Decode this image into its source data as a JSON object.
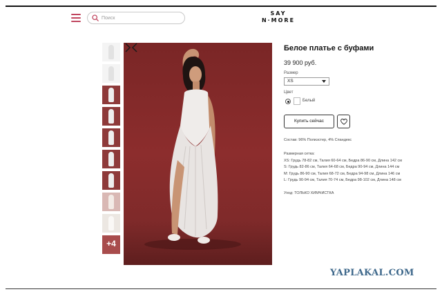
{
  "header": {
    "search_placeholder": "Поиск",
    "logo_line1": "SAY",
    "logo_line2": "N·MORE",
    "accent_color": "#c0455e"
  },
  "gallery": {
    "thumbnail_count": 10,
    "more_label": "+4",
    "photo_background_color": "#8c2d2d"
  },
  "product": {
    "title": "Белое платье с буфами",
    "price": "39 900 руб.",
    "size_label": "Размер",
    "size_value": "XS",
    "color_label": "Цвет",
    "color_name": "Белый",
    "buy_button": "Купить сейчас",
    "composition": "Состав: 96% Полиэстер, 4% Спандекс",
    "size_chart_title": "Размерная сетка:",
    "size_chart": [
      "XS: Грудь 78-82 см, Талия 60-64 см, Бедра 86-90 см, Длина 142 см",
      "S: Грудь 82-86 см, Талия 64-68 см, Бедра 90-94 см, Длина 144 см",
      "M: Грудь 86-90 см, Талия 68-72 см, Бедра 94-98 см, Длина 146 см",
      "L: Грудь 90-94 см, Талия 70-74 см, Бедра 98-102 см, Длина 148 см"
    ],
    "care": "Уход: ТОЛЬКО ХИМЧИСТКА"
  },
  "watermark": "YAPLAKAL.COM"
}
